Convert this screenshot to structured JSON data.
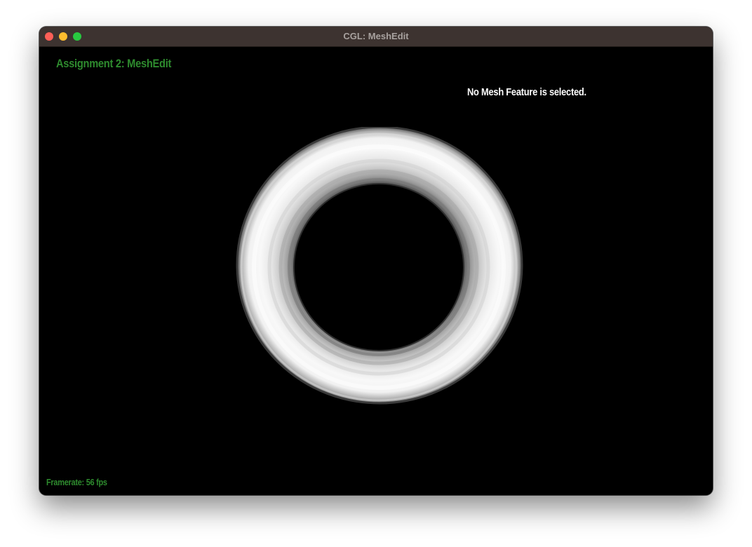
{
  "window": {
    "title": "CGL: MeshEdit"
  },
  "hud": {
    "assignment_title": "Assignment 2: MeshEdit",
    "selection_status": "No Mesh Feature is selected.",
    "framerate": "Framerate: 56 fps"
  },
  "colors": {
    "titlebar": "#3d3330",
    "hud_green": "#2e8b2e",
    "viewport_bg": "#000000",
    "status_text": "#ffffff"
  },
  "icons": {
    "close": "red-circle",
    "minimize": "yellow-circle",
    "maximize": "green-circle"
  }
}
